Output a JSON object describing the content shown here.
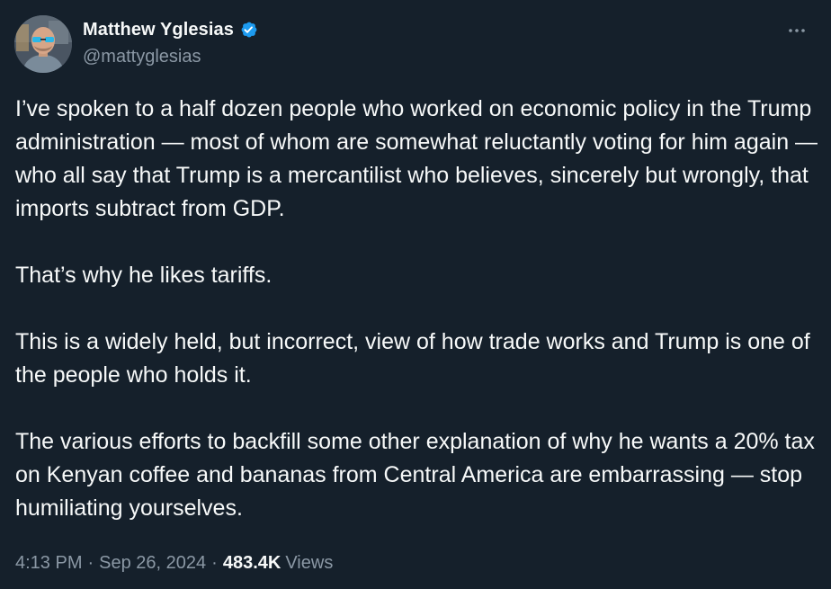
{
  "author": {
    "display_name": "Matthew Yglesias",
    "handle": "@mattyglesias",
    "verified": true,
    "avatar_icon": "profile-photo"
  },
  "tweet": {
    "paragraphs": [
      "I’ve spoken to a half dozen people who worked on economic policy in the Trump administration — most of whom are somewhat reluctantly voting for him again — who all say that Trump is a mercantilist who believes, sincerely but wrongly, that imports subtract from GDP.",
      "That’s why he likes tariffs.",
      "This is a widely held, but incorrect, view of how trade works and Trump is one of the people who holds it.",
      "The various efforts to backfill some other explanation of why he wants a 20% tax on Kenyan coffee and bananas from Central America are embarrassing — stop humiliating yourselves."
    ],
    "time": "4:13 PM",
    "date": "Sep 26, 2024",
    "separator": "·",
    "views_count": "483.4K",
    "views_label": "Views"
  },
  "icons": {
    "more": "more-horizontal-icon",
    "verified": "verified-badge-icon"
  },
  "colors": {
    "background": "#15202b",
    "text_primary": "#f7f9f9",
    "text_secondary": "#8b98a5",
    "verified_blue": "#1d9bf0"
  }
}
